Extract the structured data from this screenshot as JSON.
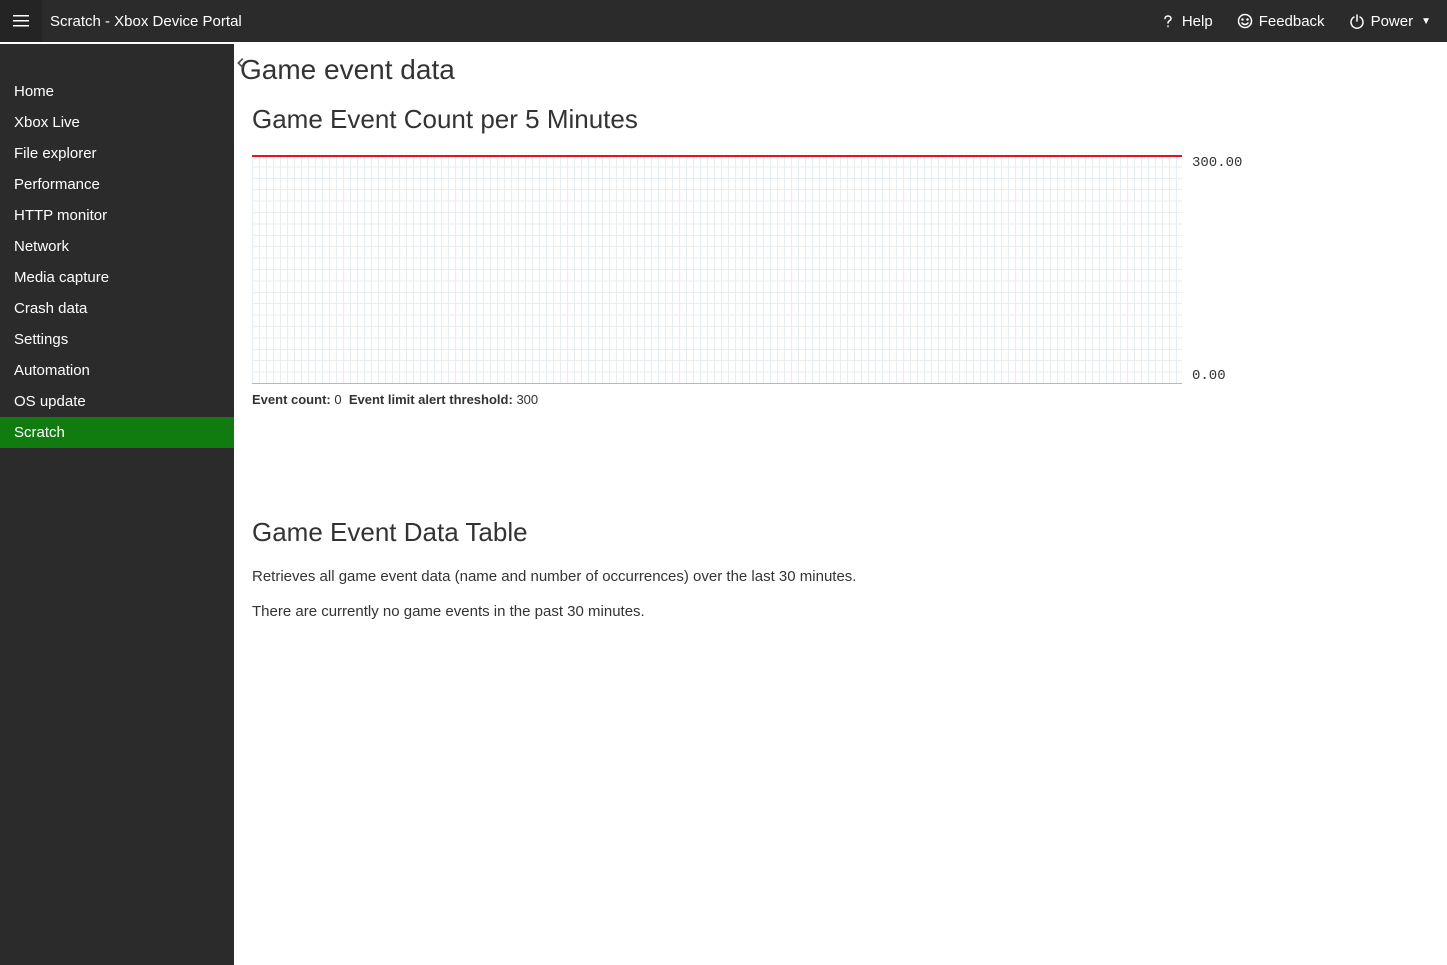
{
  "header": {
    "title": "Scratch - Xbox Device Portal",
    "help": "Help",
    "feedback": "Feedback",
    "power": "Power"
  },
  "sidebar": {
    "items": [
      {
        "label": "Home",
        "active": false
      },
      {
        "label": "Xbox Live",
        "active": false
      },
      {
        "label": "File explorer",
        "active": false
      },
      {
        "label": "Performance",
        "active": false
      },
      {
        "label": "HTTP monitor",
        "active": false
      },
      {
        "label": "Network",
        "active": false
      },
      {
        "label": "Media capture",
        "active": false
      },
      {
        "label": "Crash data",
        "active": false
      },
      {
        "label": "Settings",
        "active": false
      },
      {
        "label": "Automation",
        "active": false
      },
      {
        "label": "OS update",
        "active": false
      },
      {
        "label": "Scratch",
        "active": true
      }
    ]
  },
  "page": {
    "title": "Game event data",
    "chart_section_title": "Game Event Count per 5 Minutes",
    "footer_count_label": "Event count:",
    "footer_count_value": "0",
    "footer_threshold_label": "Event limit alert threshold:",
    "footer_threshold_value": "300",
    "table_section_title": "Game Event Data Table",
    "table_description": "Retrieves all game event data (name and number of occurrences) over the last 30 minutes.",
    "table_empty": "There are currently no game events in the past 30 minutes."
  },
  "chart_data": {
    "type": "line",
    "title": "Game Event Count per 5 Minutes",
    "xlabel": "",
    "ylabel": "",
    "ylim": [
      0,
      300
    ],
    "y_max_label": "300.00",
    "y_min_label": "0.00",
    "threshold_line": 300,
    "series": [
      {
        "name": "Event count",
        "values": []
      }
    ]
  }
}
